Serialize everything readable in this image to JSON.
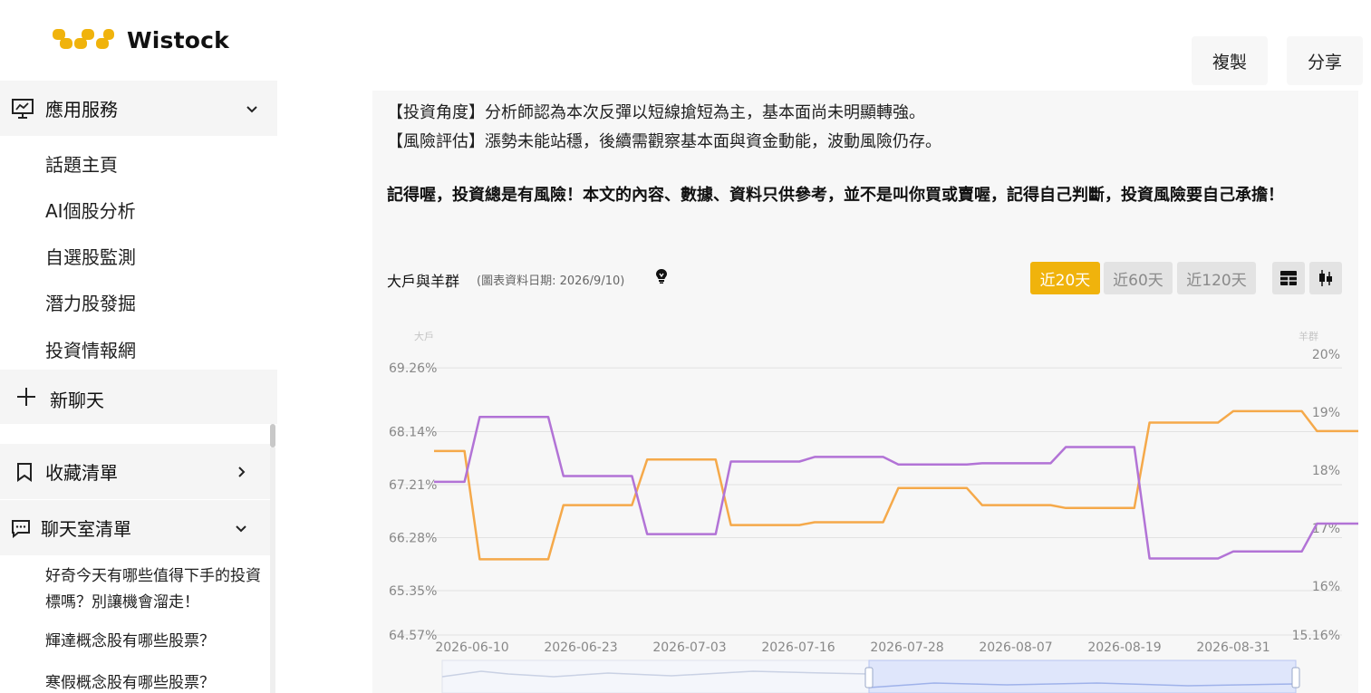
{
  "brand": {
    "name": "Wistock",
    "color": "#f0b30c"
  },
  "sidebar": {
    "services": {
      "label": "應用服務",
      "icon": "presentation-icon",
      "expanded": true
    },
    "items": [
      {
        "label": "話題主頁"
      },
      {
        "label": "AI個股分析"
      },
      {
        "label": "自選股監測"
      },
      {
        "label": "潛力股發掘"
      },
      {
        "label": "投資情報網"
      }
    ],
    "new_chat": "新聊天",
    "favorites": {
      "label": "收藏清單",
      "icon": "bookmark-icon"
    },
    "chatrooms": {
      "label": "聊天室清單",
      "icon": "chat-icon"
    },
    "chats": [
      {
        "title": "好奇今天有哪些值得下手的投資標嗎？別讓機會溜走！"
      },
      {
        "title": "輝達概念股有哪些股票？"
      },
      {
        "title": "寒假概念股有哪些股票？"
      }
    ]
  },
  "toolbar": {
    "copy": "複製",
    "share": "分享"
  },
  "article": {
    "p1": "【投資角度】分析師認為本次反彈以短線搶短為主，基本面尚未明顯轉強。",
    "p2": "【風險評估】漲勢未能站穩，後續需觀察基本面與資金動能，波動風險仍存。",
    "warning": "記得喔，投資總是有風險！本文的內容、數據、資料只供參考，並不是叫你買或賣喔，記得自己判斷，投資風險要自己承擔！"
  },
  "chart_header": {
    "title": "大戶與羊群",
    "date_note": "(圖表資料日期: 2026/9/10)",
    "ranges": [
      "近20天",
      "近60天",
      "近120天"
    ],
    "active_range": 0
  },
  "chart_data": {
    "type": "line",
    "left_axis_label": "大戶",
    "right_axis_label": "羊群",
    "left_ticks": [
      "69.26%",
      "68.14%",
      "67.21%",
      "66.28%",
      "65.35%",
      "64.57%"
    ],
    "left_tick_values": [
      69.26,
      68.14,
      67.21,
      66.28,
      65.35,
      64.57
    ],
    "right_ticks": [
      "20%",
      "19%",
      "18%",
      "17%",
      "16%",
      "15.16%"
    ],
    "right_tick_values": [
      20,
      19,
      18,
      17,
      16,
      15.16
    ],
    "left_range": [
      64.57,
      69.5
    ],
    "right_range": [
      15.16,
      20.0
    ],
    "x_labels": [
      "2026-06-10",
      "2026-06-23",
      "2026-07-03",
      "2026-07-16",
      "2026-07-28",
      "2026-08-07",
      "2026-08-19",
      "2026-08-31"
    ],
    "series": [
      {
        "name": "大戶",
        "color": "#f5a94a",
        "axis": "left",
        "points": [
          [
            0,
            67.8
          ],
          [
            0.28,
            67.8
          ],
          [
            0.42,
            65.9
          ],
          [
            1.05,
            65.9
          ],
          [
            1.19,
            66.85
          ],
          [
            1.82,
            66.85
          ],
          [
            1.96,
            67.65
          ],
          [
            2.59,
            67.65
          ],
          [
            2.73,
            66.5
          ],
          [
            3.36,
            66.5
          ],
          [
            3.5,
            66.55
          ],
          [
            4.13,
            66.55
          ],
          [
            4.27,
            67.15
          ],
          [
            4.9,
            67.15
          ],
          [
            5.04,
            66.85
          ],
          [
            5.67,
            66.85
          ],
          [
            5.81,
            66.8
          ],
          [
            6.44,
            66.8
          ],
          [
            6.58,
            68.3
          ],
          [
            7.21,
            68.3
          ],
          [
            7.35,
            68.5
          ],
          [
            7.98,
            68.5
          ],
          [
            8.12,
            68.15
          ],
          [
            8.75,
            68.15
          ],
          [
            8.89,
            68.6
          ],
          [
            9.52,
            68.6
          ],
          [
            9.66,
            65.95
          ]
        ]
      },
      {
        "name": "羊群",
        "color": "#b273d6",
        "axis": "right",
        "points": [
          [
            0,
            17.8
          ],
          [
            0.28,
            17.8
          ],
          [
            0.42,
            18.92
          ],
          [
            1.05,
            18.92
          ],
          [
            1.19,
            17.9
          ],
          [
            1.82,
            17.9
          ],
          [
            1.96,
            16.9
          ],
          [
            2.59,
            16.9
          ],
          [
            2.73,
            18.15
          ],
          [
            3.36,
            18.15
          ],
          [
            3.5,
            18.23
          ],
          [
            4.13,
            18.23
          ],
          [
            4.27,
            18.1
          ],
          [
            4.9,
            18.1
          ],
          [
            5.04,
            18.12
          ],
          [
            5.67,
            18.12
          ],
          [
            5.81,
            18.4
          ],
          [
            6.44,
            18.4
          ],
          [
            6.58,
            16.48
          ],
          [
            7.21,
            16.48
          ],
          [
            7.35,
            16.6
          ],
          [
            7.98,
            16.6
          ],
          [
            8.12,
            17.08
          ],
          [
            8.75,
            17.08
          ],
          [
            8.89,
            16.4
          ],
          [
            9.52,
            16.4
          ],
          [
            9.66,
            18.75
          ]
        ]
      }
    ],
    "grid": true,
    "has_range_slider": true
  }
}
